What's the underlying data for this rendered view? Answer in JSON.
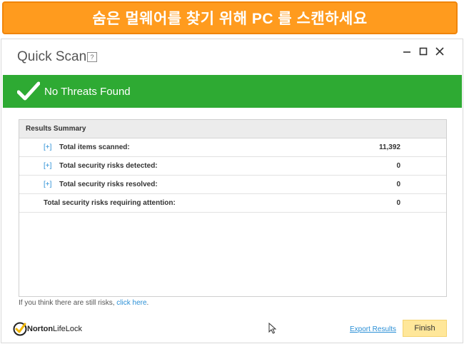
{
  "banner": {
    "text": "숨은 멀웨어를 찾기 위해 PC 를 스캔하세요"
  },
  "window": {
    "title": "Quick Scan",
    "help_label": "?",
    "controls": [
      "minimize-icon",
      "maximize-icon",
      "close-icon"
    ]
  },
  "status": {
    "text": "No Threats Found",
    "color": "#2eaa33",
    "icon": "checkmark-icon"
  },
  "summary": {
    "header": "Results Summary",
    "expand_label": "[+]",
    "rows": [
      {
        "label": "Total items scanned:",
        "value": "11,392",
        "expandable": true
      },
      {
        "label": "Total security risks detected:",
        "value": "0",
        "expandable": true
      },
      {
        "label": "Total security risks resolved:",
        "value": "0",
        "expandable": true
      },
      {
        "label": "Total security risks requiring attention:",
        "value": "0",
        "expandable": false
      }
    ]
  },
  "hint": {
    "prefix": "If you think there are still risks, ",
    "link": "click here",
    "suffix": "."
  },
  "footer": {
    "brand_norton": "Norton",
    "brand_lifelock": "LifeLock",
    "export_label": "Export Results",
    "finish_label": "Finish"
  },
  "colors": {
    "banner": "#ff9b1e",
    "accent_link": "#2a8fd6",
    "finish_button": "#ffe79a"
  }
}
